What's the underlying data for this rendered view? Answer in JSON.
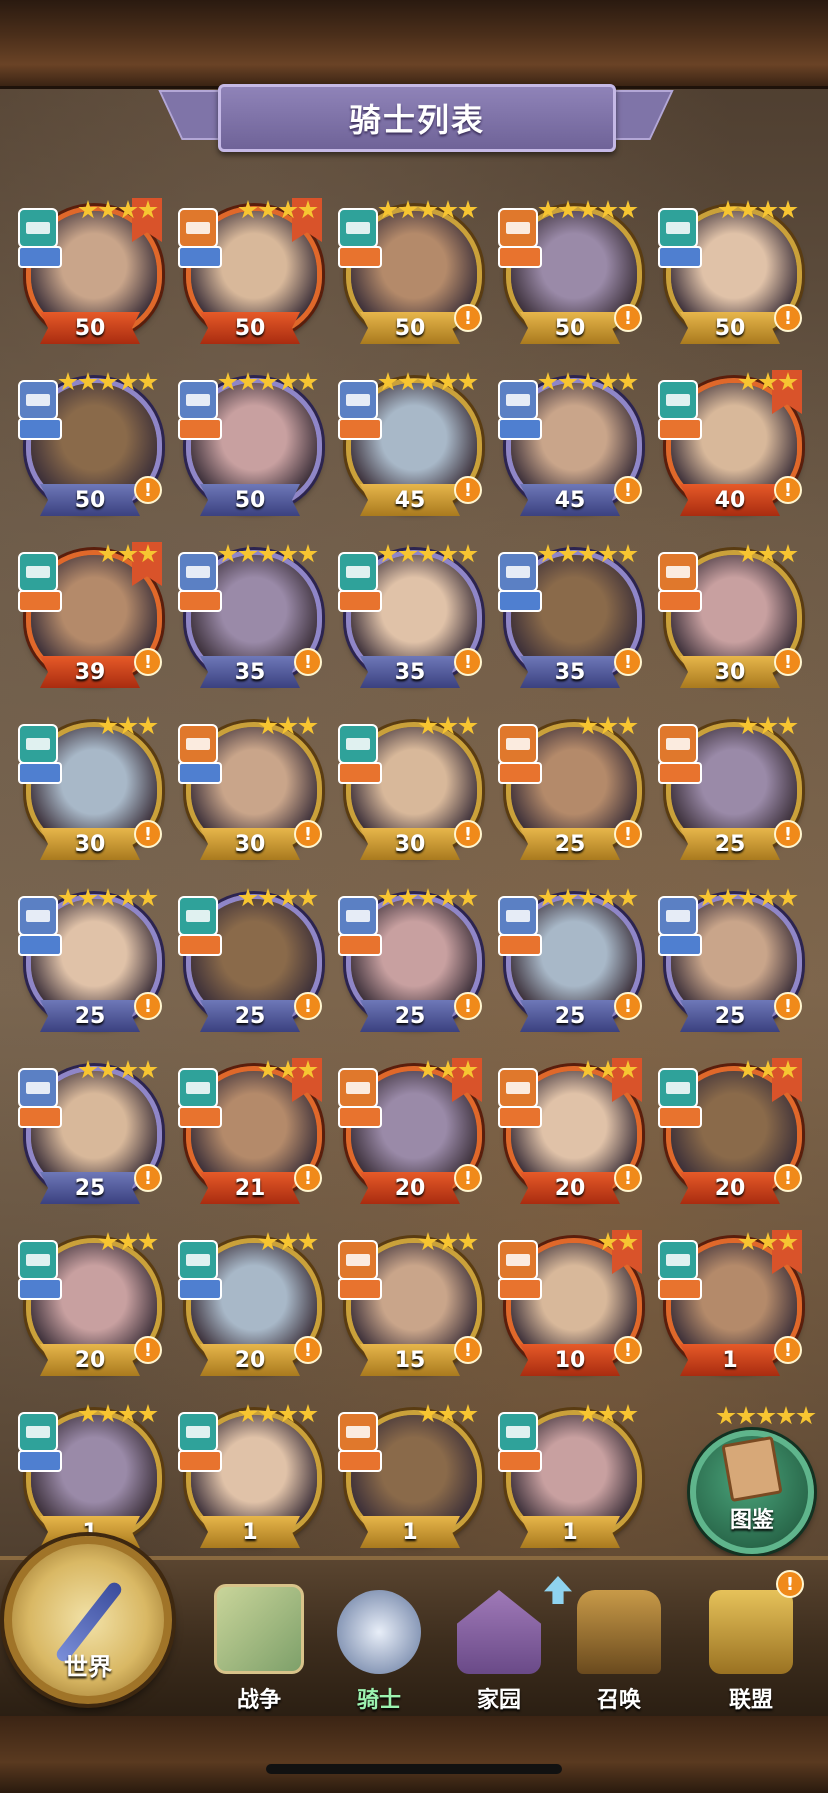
{
  "header": {
    "title": "骑士列表"
  },
  "colors": {
    "element_teal": "#2fa29a",
    "element_orange": "#e0782c",
    "element_blue": "#5b80c4",
    "class_blue": "#4f7fd0",
    "class_orange": "#e8732e",
    "alert": "#f08a1a"
  },
  "knights": [
    {
      "level": "50",
      "stars": 4,
      "frame": "red",
      "element": "teal",
      "class": "blue",
      "class_icon": "heart-icon",
      "alert": false
    },
    {
      "level": "50",
      "stars": 4,
      "frame": "red",
      "element": "orange",
      "class": "blue",
      "class_icon": "sword-icon",
      "alert": false
    },
    {
      "level": "50",
      "stars": 5,
      "frame": "gold",
      "element": "teal",
      "class": "orange",
      "class_icon": "sword-icon",
      "alert": true
    },
    {
      "level": "50",
      "stars": 5,
      "frame": "gold",
      "element": "orange",
      "class": "orange",
      "class_icon": "dots-icon",
      "alert": true
    },
    {
      "level": "50",
      "stars": 4,
      "frame": "gold",
      "element": "teal",
      "class": "blue",
      "class_icon": "heart-icon",
      "alert": true
    },
    {
      "level": "50",
      "stars": 5,
      "frame": "purple",
      "element": "blue",
      "class": "blue",
      "class_icon": "heart-icon",
      "alert": true
    },
    {
      "level": "50",
      "stars": 5,
      "frame": "purple",
      "element": "blue",
      "class": "orange",
      "class_icon": "sword-icon",
      "alert": false
    },
    {
      "level": "45",
      "stars": 5,
      "frame": "gold",
      "element": "blue",
      "class": "orange",
      "class_icon": "sword-icon",
      "alert": true
    },
    {
      "level": "45",
      "stars": 5,
      "frame": "purple",
      "element": "blue",
      "class": "blue",
      "class_icon": "heart-icon",
      "alert": true
    },
    {
      "level": "40",
      "stars": 3,
      "frame": "red",
      "element": "teal",
      "class": "orange",
      "class_icon": "sword-icon",
      "alert": true
    },
    {
      "level": "39",
      "stars": 3,
      "frame": "red",
      "element": "teal",
      "class": "orange",
      "class_icon": "sword-icon",
      "alert": true
    },
    {
      "level": "35",
      "stars": 5,
      "frame": "purple",
      "element": "blue",
      "class": "orange",
      "class_icon": "dots-icon",
      "alert": true
    },
    {
      "level": "35",
      "stars": 5,
      "frame": "purple",
      "element": "teal",
      "class": "orange",
      "class_icon": "sword-icon",
      "alert": true
    },
    {
      "level": "35",
      "stars": 5,
      "frame": "purple",
      "element": "blue",
      "class": "blue",
      "class_icon": "dots-icon",
      "alert": true
    },
    {
      "level": "30",
      "stars": 3,
      "frame": "gold",
      "element": "orange",
      "class": "orange",
      "class_icon": "sword-icon",
      "alert": true
    },
    {
      "level": "30",
      "stars": 3,
      "frame": "gold",
      "element": "teal",
      "class": "blue",
      "class_icon": "sword-icon",
      "alert": true
    },
    {
      "level": "30",
      "stars": 3,
      "frame": "gold",
      "element": "orange",
      "class": "blue",
      "class_icon": "sword-icon",
      "alert": true
    },
    {
      "level": "30",
      "stars": 3,
      "frame": "gold",
      "element": "teal",
      "class": "orange",
      "class_icon": "sword-icon",
      "alert": true
    },
    {
      "level": "25",
      "stars": 3,
      "frame": "gold",
      "element": "orange",
      "class": "orange",
      "class_icon": "dots-icon",
      "alert": true
    },
    {
      "level": "25",
      "stars": 3,
      "frame": "gold",
      "element": "orange",
      "class": "orange",
      "class_icon": "sword-icon",
      "alert": true
    },
    {
      "level": "25",
      "stars": 5,
      "frame": "purple",
      "element": "blue",
      "class": "blue",
      "class_icon": "sword-icon",
      "alert": true
    },
    {
      "level": "25",
      "stars": 4,
      "frame": "purple",
      "element": "teal",
      "class": "orange",
      "class_icon": "sword-icon",
      "alert": true
    },
    {
      "level": "25",
      "stars": 5,
      "frame": "purple",
      "element": "blue",
      "class": "orange",
      "class_icon": "sword-icon",
      "alert": true
    },
    {
      "level": "25",
      "stars": 5,
      "frame": "purple",
      "element": "blue",
      "class": "orange",
      "class_icon": "dots-icon",
      "alert": true
    },
    {
      "level": "25",
      "stars": 5,
      "frame": "purple",
      "element": "blue",
      "class": "blue",
      "class_icon": "sword-icon",
      "alert": true
    },
    {
      "level": "25",
      "stars": 4,
      "frame": "purple",
      "element": "blue",
      "class": "orange",
      "class_icon": "sword-icon",
      "alert": true
    },
    {
      "level": "21",
      "stars": 3,
      "frame": "red",
      "element": "teal",
      "class": "orange",
      "class_icon": "sword-icon",
      "alert": true
    },
    {
      "level": "20",
      "stars": 3,
      "frame": "red",
      "element": "orange",
      "class": "orange",
      "class_icon": "sword-icon",
      "alert": true
    },
    {
      "level": "20",
      "stars": 3,
      "frame": "red",
      "element": "orange",
      "class": "orange",
      "class_icon": "sword-icon",
      "alert": true
    },
    {
      "level": "20",
      "stars": 3,
      "frame": "red",
      "element": "teal",
      "class": "orange",
      "class_icon": "sword-icon",
      "alert": true
    },
    {
      "level": "20",
      "stars": 3,
      "frame": "gold",
      "element": "teal",
      "class": "blue",
      "class_icon": "dots-icon",
      "alert": true
    },
    {
      "level": "20",
      "stars": 3,
      "frame": "gold",
      "element": "teal",
      "class": "blue",
      "class_icon": "heart-icon",
      "alert": true
    },
    {
      "level": "15",
      "stars": 3,
      "frame": "gold",
      "element": "orange",
      "class": "orange",
      "class_icon": "sword-icon",
      "alert": true
    },
    {
      "level": "10",
      "stars": 2,
      "frame": "red",
      "element": "orange",
      "class": "orange",
      "class_icon": "sword-icon",
      "alert": true
    },
    {
      "level": "1",
      "stars": 3,
      "frame": "red",
      "element": "teal",
      "class": "orange",
      "class_icon": "sword-icon",
      "alert": true
    },
    {
      "level": "1",
      "stars": 4,
      "frame": "gold",
      "element": "teal",
      "class": "blue",
      "class_icon": "heart-icon",
      "alert": false
    },
    {
      "level": "1",
      "stars": 4,
      "frame": "gold",
      "element": "teal",
      "class": "orange",
      "class_icon": "sword-icon",
      "alert": false
    },
    {
      "level": "1",
      "stars": 3,
      "frame": "gold",
      "element": "orange",
      "class": "orange",
      "class_icon": "sword-icon",
      "alert": false
    },
    {
      "level": "1",
      "stars": 3,
      "frame": "gold",
      "element": "teal",
      "class": "orange",
      "class_icon": "heart-icon",
      "alert": false
    }
  ],
  "codex": {
    "label": "图鉴",
    "stars": 5
  },
  "nav": {
    "world": "世界",
    "war": "战争",
    "knights": "骑士",
    "home": "家园",
    "summon": "召唤",
    "alliance": "联盟",
    "alliance_badge": "!"
  }
}
